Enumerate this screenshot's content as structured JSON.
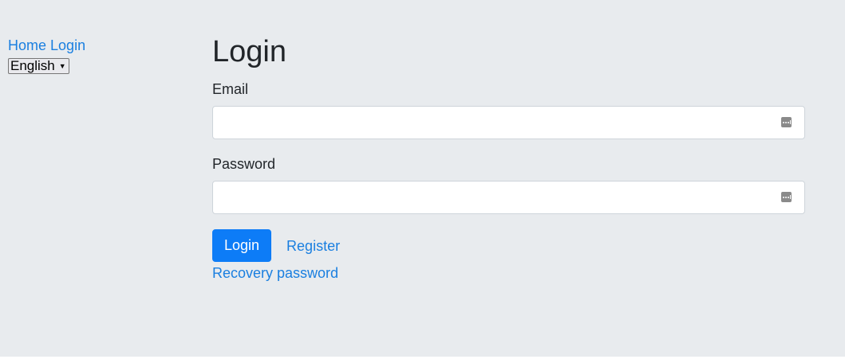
{
  "sidebar": {
    "links": [
      {
        "label": "Home"
      },
      {
        "label": "Login"
      }
    ],
    "language": {
      "selected": "English"
    }
  },
  "main": {
    "title": "Login",
    "email": {
      "label": "Email",
      "value": "",
      "placeholder": ""
    },
    "password": {
      "label": "Password",
      "value": "",
      "placeholder": ""
    },
    "login_button": "Login",
    "register_link": "Register",
    "recovery_link": "Recovery password"
  },
  "colors": {
    "background": "#e8ebee",
    "link": "#1a7fe0",
    "primary_button": "#0d7cf7"
  },
  "icons": {
    "input_trailing": "autofill-key-icon",
    "select_caret": "caret-down-icon"
  }
}
